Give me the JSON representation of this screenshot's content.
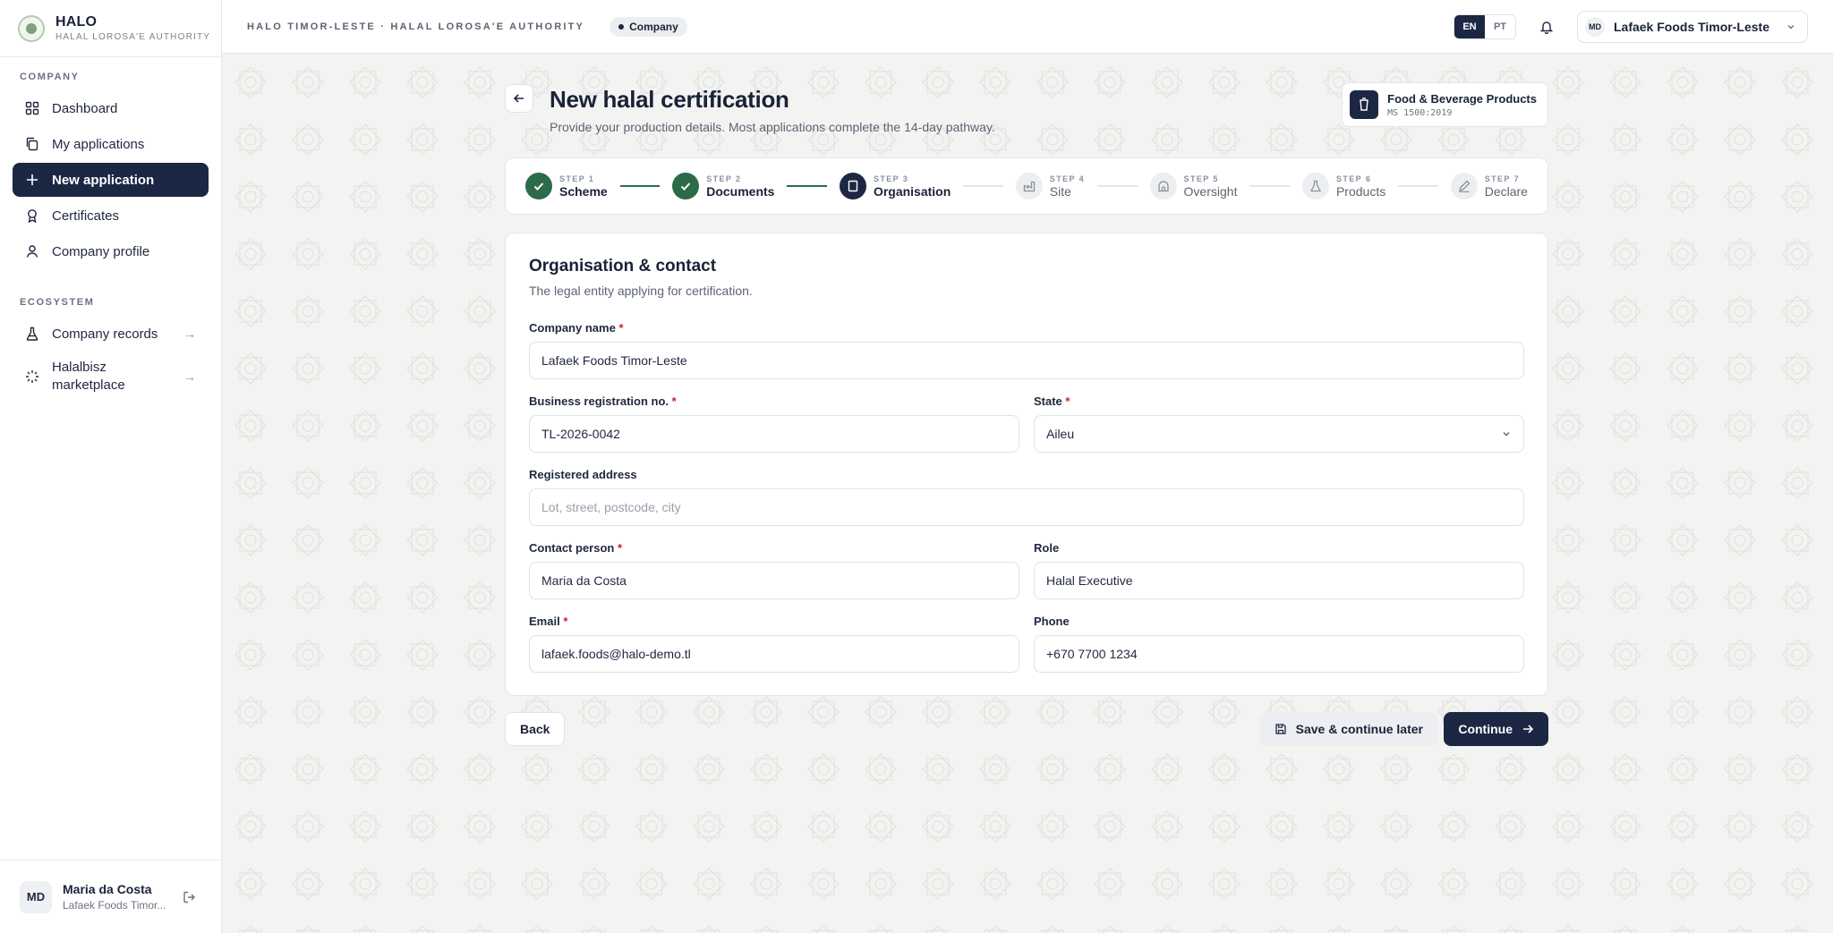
{
  "brand": {
    "name": "HALO",
    "subtitle": "HALAL LOROSA'E AUTHORITY"
  },
  "sidebar": {
    "company_heading": "COMPANY",
    "company_items": [
      {
        "label": "Dashboard",
        "icon": "grid-icon"
      },
      {
        "label": "My applications",
        "icon": "copy-icon"
      },
      {
        "label": "New application",
        "icon": "plus-icon",
        "active": true
      },
      {
        "label": "Certificates",
        "icon": "award-icon"
      },
      {
        "label": "Company profile",
        "icon": "user-icon"
      }
    ],
    "ecosystem_heading": "ECOSYSTEM",
    "ecosystem_items": [
      {
        "label": "Company records",
        "icon": "flask-icon"
      },
      {
        "label": "Halalbisz marketplace",
        "icon": "loader-icon"
      }
    ],
    "user": {
      "initials": "MD",
      "name": "Maria da Costa",
      "org": "Lafaek Foods Timor..."
    }
  },
  "topbar": {
    "authority": "HALO TIMOR-LESTE · HALAL LOROSA'E AUTHORITY",
    "role": "Company",
    "languages": [
      "EN",
      "PT"
    ],
    "active_language": "EN",
    "org_initials": "MD",
    "org_name": "Lafaek Foods Timor-Leste"
  },
  "page": {
    "title": "New halal certification",
    "subtitle": "Provide your production details. Most applications complete the 14-day pathway.",
    "scheme": {
      "name": "Food & Beverage Products",
      "code": "MS 1500:2019"
    }
  },
  "steps": [
    {
      "num": "STEP 1",
      "label": "Scheme",
      "status": "done"
    },
    {
      "num": "STEP 2",
      "label": "Documents",
      "status": "done"
    },
    {
      "num": "STEP 3",
      "label": "Organisation",
      "status": "current"
    },
    {
      "num": "STEP 4",
      "label": "Site",
      "status": "todo"
    },
    {
      "num": "STEP 5",
      "label": "Oversight",
      "status": "todo"
    },
    {
      "num": "STEP 6",
      "label": "Products",
      "status": "todo"
    },
    {
      "num": "STEP 7",
      "label": "Declare",
      "status": "todo"
    }
  ],
  "form": {
    "title": "Organisation & contact",
    "subtitle": "The legal entity applying for certification.",
    "company_name": {
      "label": "Company name",
      "value": "Lafaek Foods Timor-Leste"
    },
    "brn": {
      "label": "Business registration no.",
      "value": "TL-2026-0042"
    },
    "state": {
      "label": "State",
      "value": "Aileu"
    },
    "address": {
      "label": "Registered address",
      "placeholder": "Lot, street, postcode, city"
    },
    "contact": {
      "label": "Contact person",
      "value": "Maria da Costa"
    },
    "role": {
      "label": "Role",
      "value": "Halal Executive"
    },
    "email": {
      "label": "Email",
      "value": "lafaek.foods@halo-demo.tl"
    },
    "phone": {
      "label": "Phone",
      "value": "+670 7700 1234"
    },
    "required_mark": "*"
  },
  "actions": {
    "back": "Back",
    "save": "Save & continue later",
    "continue": "Continue"
  },
  "colors": {
    "navy": "#1c2744",
    "green": "#2b6b48",
    "required": "#c8223a"
  }
}
